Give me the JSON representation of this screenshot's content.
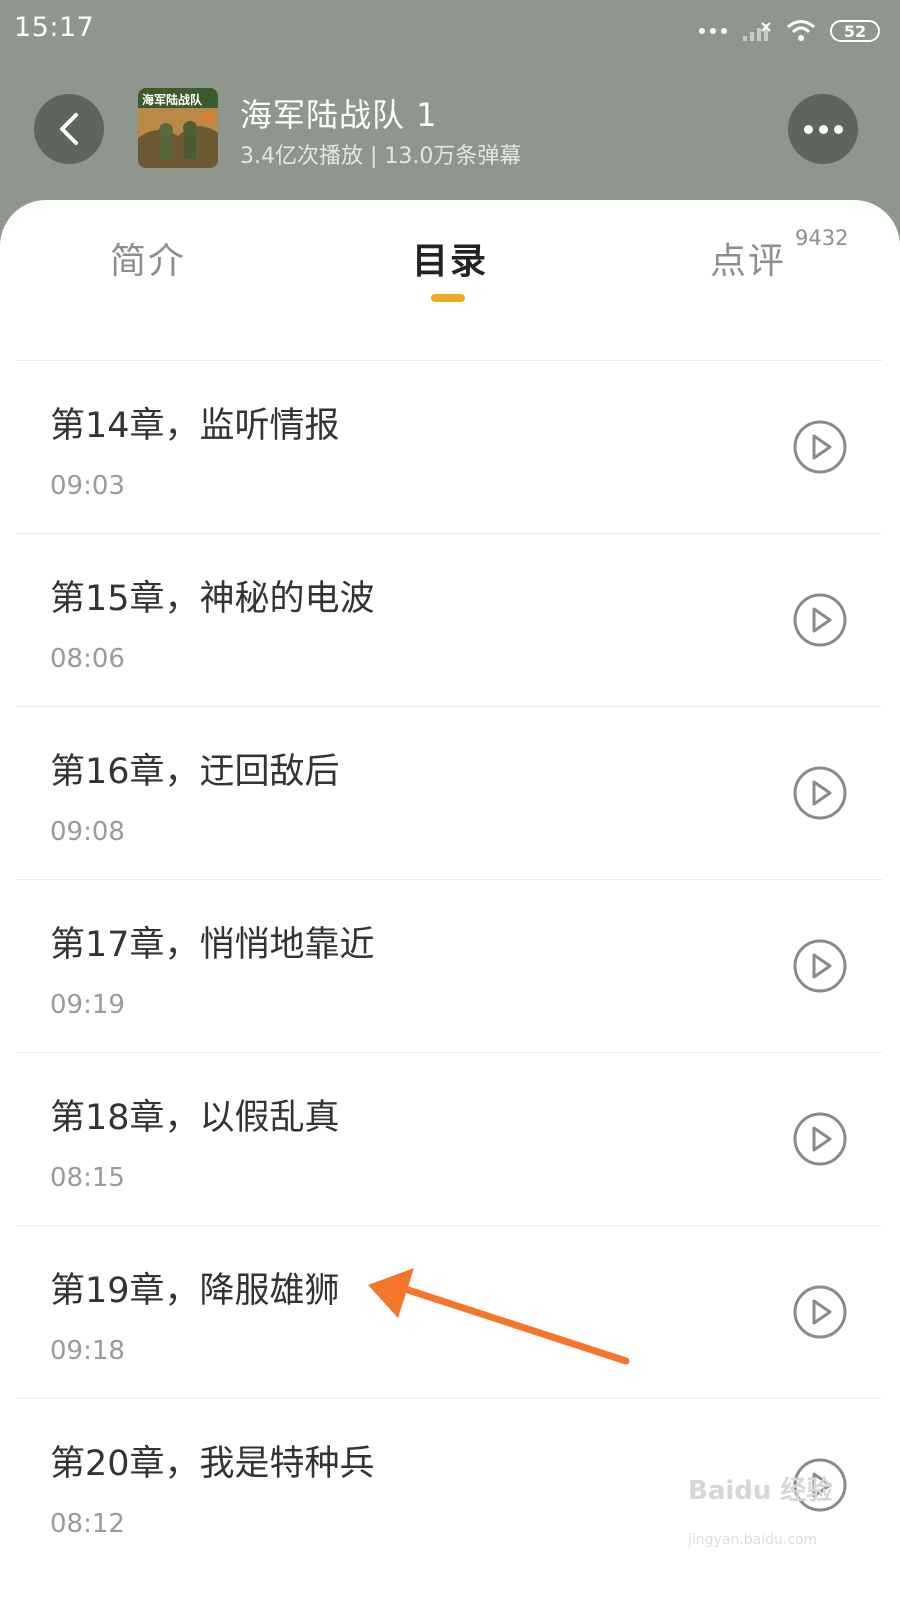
{
  "status_bar": {
    "time": "15:17",
    "battery": "52",
    "icons": [
      "dots-icon",
      "signal-icon",
      "wifi-icon",
      "battery-icon"
    ]
  },
  "header": {
    "title": "海军陆战队 1",
    "stats": "3.4亿次播放 | 13.0万条弹幕",
    "cover_text": "海军陆战队",
    "back_icon": "chevron-left-icon",
    "more_icon": "more-dots-icon"
  },
  "tabs": [
    {
      "label": "简介",
      "active": false
    },
    {
      "label": "目录",
      "active": true
    },
    {
      "label": "点评",
      "badge": "9432",
      "active": false
    }
  ],
  "chapters": [
    {
      "title": "第14章，监听情报",
      "duration": "09:03"
    },
    {
      "title": "第15章，神秘的电波",
      "duration": "08:06"
    },
    {
      "title": "第16章，迂回敌后",
      "duration": "09:08"
    },
    {
      "title": "第17章，悄悄地靠近",
      "duration": "09:19"
    },
    {
      "title": "第18章，以假乱真",
      "duration": "08:15"
    },
    {
      "title": "第19章，降服雄狮",
      "duration": "09:18"
    },
    {
      "title": "第20章，我是特种兵",
      "duration": "08:12"
    }
  ],
  "watermark": {
    "text": "Baidu 经验",
    "sub": "jingyan.baidu.com"
  },
  "colors": {
    "header_bg": "#8f968d",
    "accent": "#f5a623",
    "annotation_arrow": "#f5762a"
  }
}
